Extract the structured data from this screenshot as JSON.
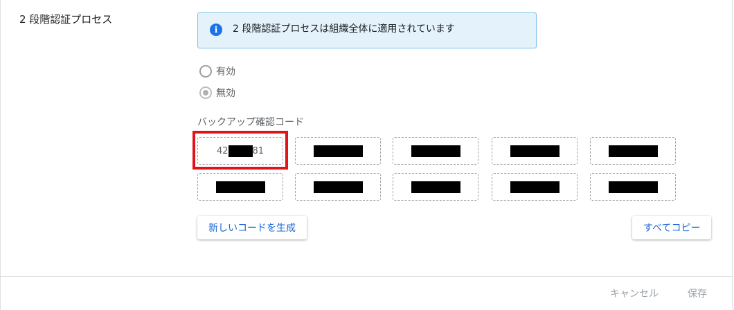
{
  "section": {
    "title": "2 段階認証プロセス"
  },
  "banner": {
    "icon": "info-icon",
    "icon_glyph": "i",
    "text": "2 段階認証プロセスは組織全体に適用されています"
  },
  "options": [
    {
      "label": "有効",
      "checked": false
    },
    {
      "label": "無効",
      "checked": true
    }
  ],
  "backup_codes": {
    "label": "バックアップ確認コード",
    "first_code_prefix": "42",
    "first_code_suffix": "81",
    "codes_redacted": true,
    "count": 10
  },
  "buttons": {
    "generate": "新しいコードを生成",
    "copy_all": "すべてコピー",
    "cancel": "キャンセル",
    "save": "保存"
  },
  "colors": {
    "accent": "#1a66d8",
    "highlight": "#e2121b",
    "banner_bg": "#e3f2fb",
    "banner_border": "#7cbdea"
  }
}
